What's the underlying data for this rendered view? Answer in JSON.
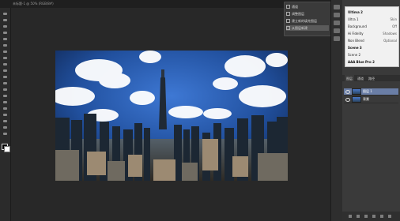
{
  "document": {
    "tab_title": "未标题-1 @ 50% (RGB/8#)"
  },
  "tools": [
    {
      "name": "move-tool-icon"
    },
    {
      "name": "marquee-tool-icon"
    },
    {
      "name": "lasso-tool-icon"
    },
    {
      "name": "quick-select-tool-icon"
    },
    {
      "name": "crop-tool-icon"
    },
    {
      "name": "eyedropper-tool-icon"
    },
    {
      "name": "healing-brush-tool-icon"
    },
    {
      "name": "brush-tool-icon"
    },
    {
      "name": "clone-stamp-tool-icon"
    },
    {
      "name": "history-brush-tool-icon"
    },
    {
      "name": "eraser-tool-icon"
    },
    {
      "name": "gradient-tool-icon"
    },
    {
      "name": "blur-tool-icon"
    },
    {
      "name": "dodge-tool-icon"
    },
    {
      "name": "pen-tool-icon"
    },
    {
      "name": "type-tool-icon"
    },
    {
      "name": "path-select-tool-icon"
    },
    {
      "name": "shape-tool-icon"
    },
    {
      "name": "hand-tool-icon"
    },
    {
      "name": "zoom-tool-icon"
    }
  ],
  "colors": {
    "foreground": "#000000",
    "background": "#ffffff",
    "selection": "#6a7ea6"
  },
  "dropdown": {
    "items": [
      {
        "label": "通道",
        "active": false
      },
      {
        "label": "调整图层",
        "active": false
      },
      {
        "label": "建立新的填充图层",
        "active": false
      },
      {
        "label": "从图层新建",
        "active": true
      }
    ]
  },
  "properties": {
    "rows": [
      {
        "k": "Ultima 2",
        "v": "",
        "head": true
      },
      {
        "k": "Ultra 1",
        "v": "Skin"
      },
      {
        "k": "Background",
        "v": "Off"
      },
      {
        "k": "Hi Fidelity",
        "v": "Shadows"
      },
      {
        "k": "Non Blend",
        "v": "Optional"
      },
      {
        "k": "Scene 3",
        "v": "",
        "head": true
      },
      {
        "k": "Scene 2",
        "v": ""
      },
      {
        "k": "AAA Blue Pro 2",
        "v": "",
        "head": true
      }
    ]
  },
  "layers_panel": {
    "tabs": [
      "图层",
      "通道",
      "路径"
    ],
    "layers": [
      {
        "name": "图层 1",
        "selected": true
      },
      {
        "name": "背景",
        "selected": false
      }
    ]
  }
}
